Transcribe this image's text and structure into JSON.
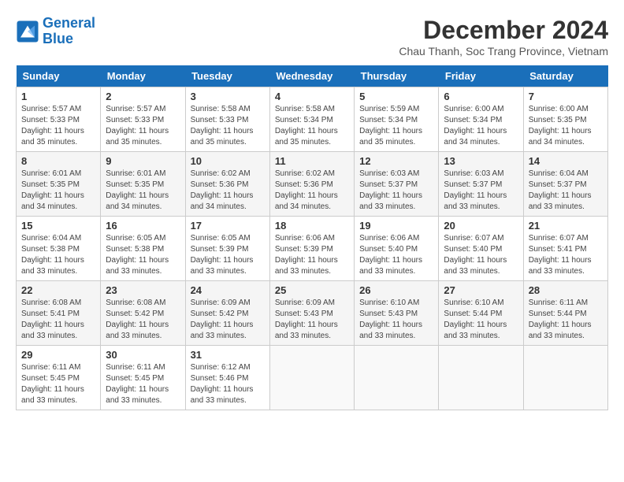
{
  "logo": {
    "line1": "General",
    "line2": "Blue"
  },
  "title": "December 2024",
  "subtitle": "Chau Thanh, Soc Trang Province, Vietnam",
  "days_of_week": [
    "Sunday",
    "Monday",
    "Tuesday",
    "Wednesday",
    "Thursday",
    "Friday",
    "Saturday"
  ],
  "weeks": [
    [
      {
        "day": "1",
        "sunrise": "5:57 AM",
        "sunset": "5:33 PM",
        "daylight": "11 hours and 35 minutes."
      },
      {
        "day": "2",
        "sunrise": "5:57 AM",
        "sunset": "5:33 PM",
        "daylight": "11 hours and 35 minutes."
      },
      {
        "day": "3",
        "sunrise": "5:58 AM",
        "sunset": "5:33 PM",
        "daylight": "11 hours and 35 minutes."
      },
      {
        "day": "4",
        "sunrise": "5:58 AM",
        "sunset": "5:34 PM",
        "daylight": "11 hours and 35 minutes."
      },
      {
        "day": "5",
        "sunrise": "5:59 AM",
        "sunset": "5:34 PM",
        "daylight": "11 hours and 35 minutes."
      },
      {
        "day": "6",
        "sunrise": "6:00 AM",
        "sunset": "5:34 PM",
        "daylight": "11 hours and 34 minutes."
      },
      {
        "day": "7",
        "sunrise": "6:00 AM",
        "sunset": "5:35 PM",
        "daylight": "11 hours and 34 minutes."
      }
    ],
    [
      {
        "day": "8",
        "sunrise": "6:01 AM",
        "sunset": "5:35 PM",
        "daylight": "11 hours and 34 minutes."
      },
      {
        "day": "9",
        "sunrise": "6:01 AM",
        "sunset": "5:35 PM",
        "daylight": "11 hours and 34 minutes."
      },
      {
        "day": "10",
        "sunrise": "6:02 AM",
        "sunset": "5:36 PM",
        "daylight": "11 hours and 34 minutes."
      },
      {
        "day": "11",
        "sunrise": "6:02 AM",
        "sunset": "5:36 PM",
        "daylight": "11 hours and 34 minutes."
      },
      {
        "day": "12",
        "sunrise": "6:03 AM",
        "sunset": "5:37 PM",
        "daylight": "11 hours and 33 minutes."
      },
      {
        "day": "13",
        "sunrise": "6:03 AM",
        "sunset": "5:37 PM",
        "daylight": "11 hours and 33 minutes."
      },
      {
        "day": "14",
        "sunrise": "6:04 AM",
        "sunset": "5:37 PM",
        "daylight": "11 hours and 33 minutes."
      }
    ],
    [
      {
        "day": "15",
        "sunrise": "6:04 AM",
        "sunset": "5:38 PM",
        "daylight": "11 hours and 33 minutes."
      },
      {
        "day": "16",
        "sunrise": "6:05 AM",
        "sunset": "5:38 PM",
        "daylight": "11 hours and 33 minutes."
      },
      {
        "day": "17",
        "sunrise": "6:05 AM",
        "sunset": "5:39 PM",
        "daylight": "11 hours and 33 minutes."
      },
      {
        "day": "18",
        "sunrise": "6:06 AM",
        "sunset": "5:39 PM",
        "daylight": "11 hours and 33 minutes."
      },
      {
        "day": "19",
        "sunrise": "6:06 AM",
        "sunset": "5:40 PM",
        "daylight": "11 hours and 33 minutes."
      },
      {
        "day": "20",
        "sunrise": "6:07 AM",
        "sunset": "5:40 PM",
        "daylight": "11 hours and 33 minutes."
      },
      {
        "day": "21",
        "sunrise": "6:07 AM",
        "sunset": "5:41 PM",
        "daylight": "11 hours and 33 minutes."
      }
    ],
    [
      {
        "day": "22",
        "sunrise": "6:08 AM",
        "sunset": "5:41 PM",
        "daylight": "11 hours and 33 minutes."
      },
      {
        "day": "23",
        "sunrise": "6:08 AM",
        "sunset": "5:42 PM",
        "daylight": "11 hours and 33 minutes."
      },
      {
        "day": "24",
        "sunrise": "6:09 AM",
        "sunset": "5:42 PM",
        "daylight": "11 hours and 33 minutes."
      },
      {
        "day": "25",
        "sunrise": "6:09 AM",
        "sunset": "5:43 PM",
        "daylight": "11 hours and 33 minutes."
      },
      {
        "day": "26",
        "sunrise": "6:10 AM",
        "sunset": "5:43 PM",
        "daylight": "11 hours and 33 minutes."
      },
      {
        "day": "27",
        "sunrise": "6:10 AM",
        "sunset": "5:44 PM",
        "daylight": "11 hours and 33 minutes."
      },
      {
        "day": "28",
        "sunrise": "6:11 AM",
        "sunset": "5:44 PM",
        "daylight": "11 hours and 33 minutes."
      }
    ],
    [
      {
        "day": "29",
        "sunrise": "6:11 AM",
        "sunset": "5:45 PM",
        "daylight": "11 hours and 33 minutes."
      },
      {
        "day": "30",
        "sunrise": "6:11 AM",
        "sunset": "5:45 PM",
        "daylight": "11 hours and 33 minutes."
      },
      {
        "day": "31",
        "sunrise": "6:12 AM",
        "sunset": "5:46 PM",
        "daylight": "11 hours and 33 minutes."
      },
      null,
      null,
      null,
      null
    ]
  ]
}
